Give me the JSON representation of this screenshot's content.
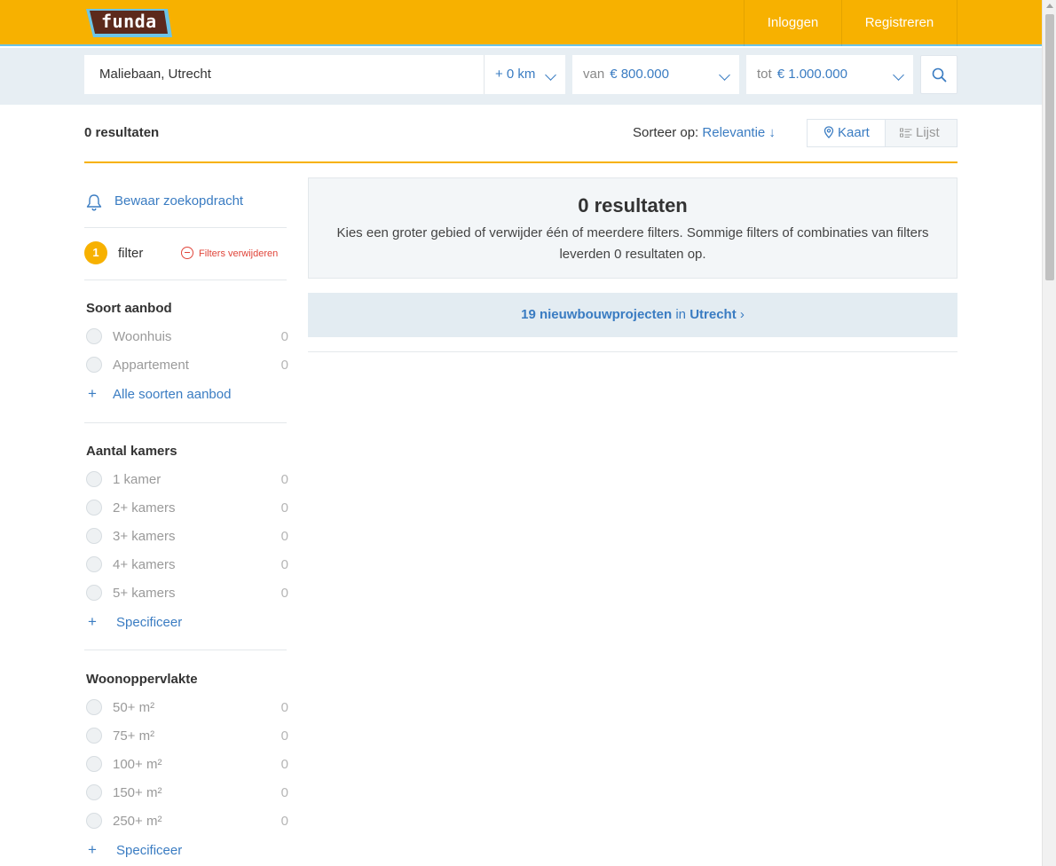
{
  "header": {
    "logo_text": "funda",
    "login_label": "Inloggen",
    "register_label": "Registreren"
  },
  "search": {
    "location_value": "Maliebaan, Utrecht",
    "radius_value": "+ 0 km",
    "price_min_prefix": "van",
    "price_min_value": "€ 800.000",
    "price_max_prefix": "tot",
    "price_max_value": "€ 1.000.000"
  },
  "results_bar": {
    "count_label": "0 resultaten",
    "sort_prefix": "Sorteer op:",
    "sort_value": "Relevantie ↓",
    "map_label": "Kaart",
    "list_label": "Lijst"
  },
  "sidebar": {
    "save_search_label": "Bewaar zoekopdracht",
    "filter_count": "1",
    "filter_label": "filter",
    "remove_filters_label": "Filters verwijderen",
    "sections": [
      {
        "title": "Soort aanbod",
        "options": [
          {
            "label": "Woonhuis",
            "count": "0"
          },
          {
            "label": "Appartement",
            "count": "0"
          }
        ],
        "more_label": "Alle soorten aanbod"
      },
      {
        "title": "Aantal kamers",
        "options": [
          {
            "label": "1 kamer",
            "count": "0"
          },
          {
            "label": "2+ kamers",
            "count": "0"
          },
          {
            "label": "3+ kamers",
            "count": "0"
          },
          {
            "label": "4+ kamers",
            "count": "0"
          },
          {
            "label": "5+ kamers",
            "count": "0"
          }
        ],
        "more_label": "Specificeer"
      },
      {
        "title": "Woonoppervlakte",
        "options": [
          {
            "label": "50+ m²",
            "count": "0"
          },
          {
            "label": "75+ m²",
            "count": "0"
          },
          {
            "label": "100+ m²",
            "count": "0"
          },
          {
            "label": "150+ m²",
            "count": "0"
          },
          {
            "label": "250+ m²",
            "count": "0"
          }
        ],
        "more_label": "Specificeer"
      }
    ]
  },
  "main": {
    "empty_title": "0 resultaten",
    "empty_message": "Kies een groter gebied of verwijder één of meerdere filters. Sommige filters of combinaties van filters leverden 0 resultaten op.",
    "new_build_count_label": "19 nieuwbouwprojecten",
    "new_build_in": "in",
    "new_build_city": "Utrecht",
    "new_build_chevron": "›"
  },
  "colors": {
    "brand_orange": "#f7b100",
    "link_blue": "#3a7cc2",
    "danger_red": "#e0453a",
    "band_bg": "#e7eef3"
  }
}
